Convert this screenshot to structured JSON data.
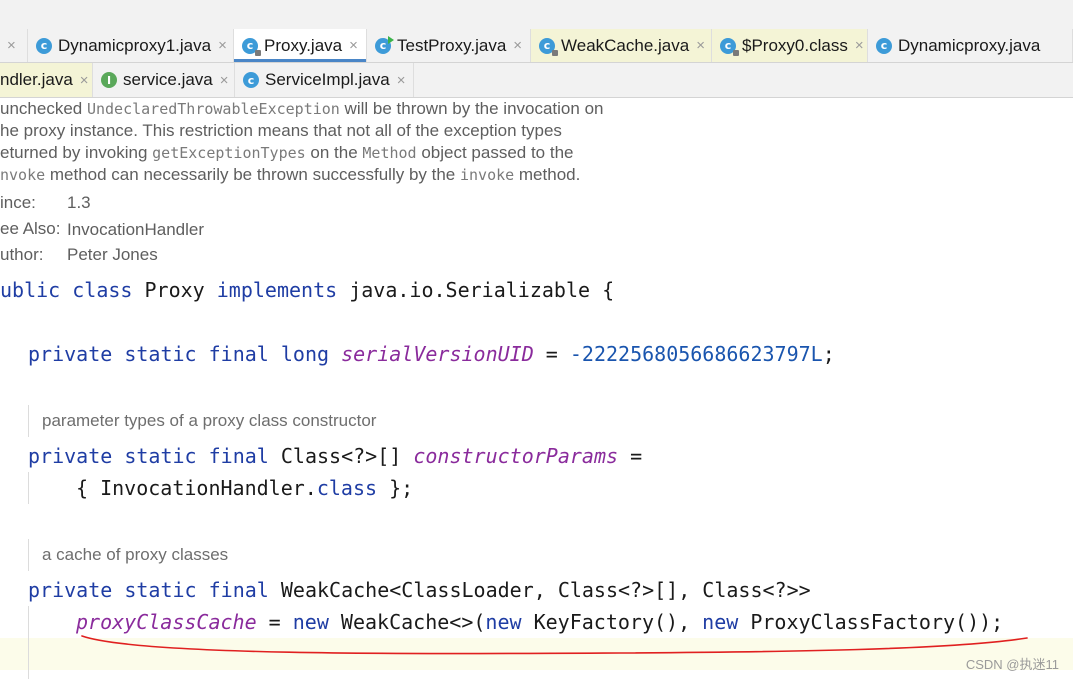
{
  "tabs_row1": [
    {
      "label": "Dynamicproxy1.java",
      "icon": "class-icon"
    },
    {
      "label": "Proxy.java",
      "icon": "class-locked-icon",
      "active": true
    },
    {
      "label": "TestProxy.java",
      "icon": "class-runnable-icon"
    },
    {
      "label": "WeakCache.java",
      "icon": "class-locked-icon"
    },
    {
      "label": "$Proxy0.class",
      "icon": "class-locked-icon"
    },
    {
      "label": "Dynamicproxy.java",
      "icon": "class-icon"
    }
  ],
  "tabs_row2": [
    {
      "label": "ndler.java"
    },
    {
      "label": "service.java",
      "icon": "interface-icon"
    },
    {
      "label": "ServiceImpl.java",
      "icon": "class-icon"
    }
  ],
  "close_glyph": "×",
  "icon_letters": {
    "class": "c",
    "interface": "I"
  },
  "javadoc": {
    "l1_a": "unchecked ",
    "l1_code": "UndeclaredThrowableException",
    "l1_b": " will be thrown by the invocation on",
    "l2": "he proxy instance. This restriction means that not all of the exception types",
    "l3_a": "eturned by invoking ",
    "l3_code1": "getExceptionTypes",
    "l3_b": " on the ",
    "l3_code2": "Method",
    "l3_c": " object passed to the",
    "l4_code1": "nvoke",
    "l4_a": " method can necessarily be thrown successfully by the ",
    "l4_code2": "invoke",
    "l4_b": " method.",
    "since_label": "ince:",
    "since_value": "1.3",
    "see_label": "ee Also:",
    "see_value": "InvocationHandler",
    "author_label": "uthor:",
    "author_value": "Peter Jones"
  },
  "code": {
    "c1_kw": "ublic class",
    "c1_a": " Proxy ",
    "c1_kw2": "implements",
    "c1_b": " java.io.Serializable {",
    "c2_kw": "private static final long",
    "c2_field": "serialVersionUID",
    "c2_a": " = ",
    "c2_num": "-2222568056686623797L",
    "c2_b": ";",
    "comment1": "parameter types of a proxy class constructor",
    "c3_kw": "private static final",
    "c3_a": " Class<?>[] ",
    "c3_field": "constructorParams",
    "c3_b": " =",
    "c4_a": "{ InvocationHandler.",
    "c4_kw": "class",
    "c4_b": " };",
    "comment2": "a cache of proxy classes",
    "c5_kw": "private static final",
    "c5_a": " WeakCache<ClassLoader, Class<?>[], Class<?>>",
    "c6_field": "proxyClassCache",
    "c6_a": " = ",
    "c6_kw1": "new",
    "c6_b": " WeakCache<>(",
    "c6_kw2": "new",
    "c6_c": " KeyFactory(), ",
    "c6_kw3": "new",
    "c6_d": " ProxyClassFactory());"
  },
  "watermark": "CSDN @执迷11",
  "colors": {
    "keyword": "#1f3da4",
    "field": "#8a2b9c",
    "number": "#1a55ae",
    "annotation_line": "#e02020"
  }
}
